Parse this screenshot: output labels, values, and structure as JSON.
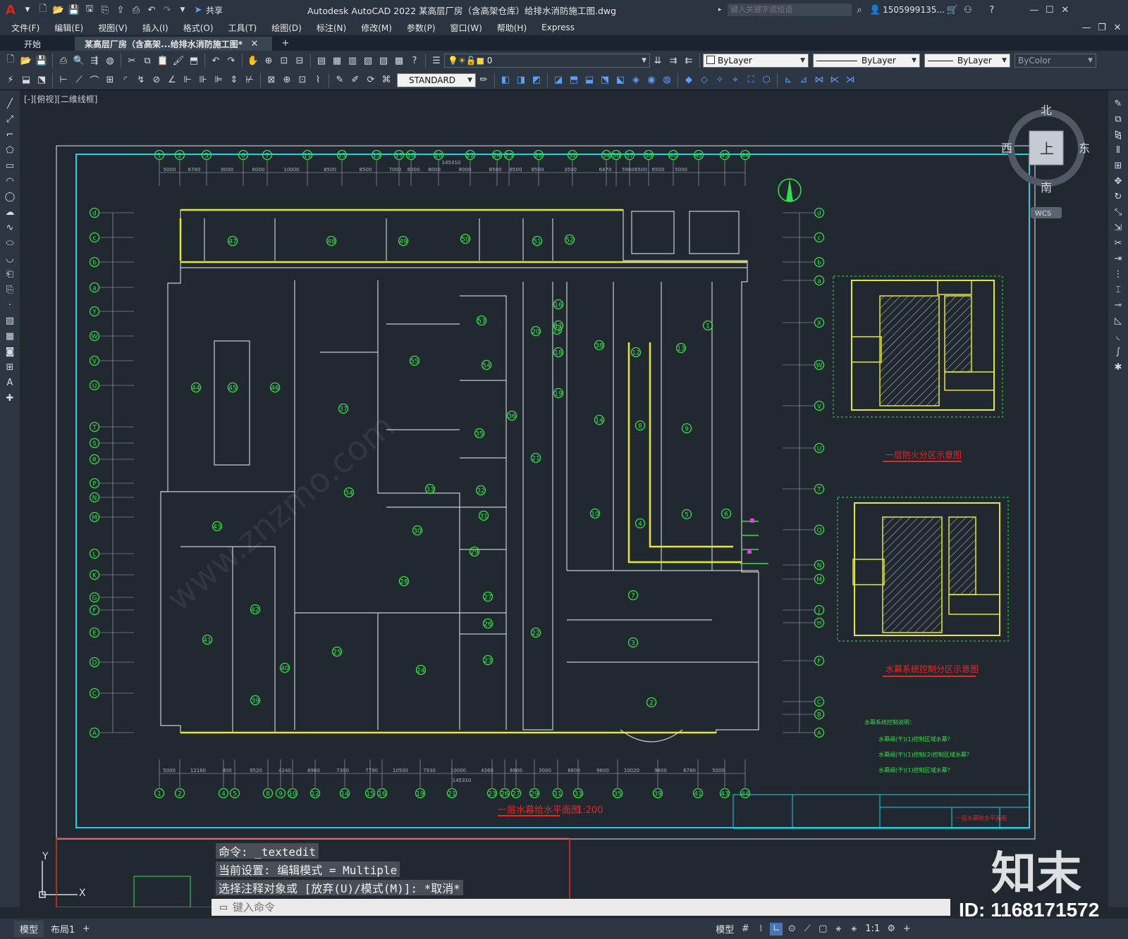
{
  "app": {
    "title": "Autodesk AutoCAD 2022    某高层厂房（含高架仓库）给排水消防施工图.dwg",
    "share_label": "共享",
    "search_placeholder": "键入关键字或短语",
    "user_id": "1505999135...",
    "logo_letter": "A"
  },
  "menu": [
    "文件(F)",
    "编辑(E)",
    "视图(V)",
    "插入(I)",
    "格式(O)",
    "工具(T)",
    "绘图(D)",
    "标注(N)",
    "修改(M)",
    "参数(P)",
    "窗口(W)",
    "帮助(H)",
    "Express"
  ],
  "tabs": {
    "start": "开始",
    "file": "某高层厂房（含高架...给排水消防施工图*"
  },
  "toolbar": {
    "layer_value": "0",
    "color_value": "ByLayer",
    "linetype_value": "ByLayer",
    "lineweight_value": "ByLayer",
    "plotstyle_value": "ByColor",
    "textstyle_value": "STANDARD"
  },
  "viewport": {
    "label": "[-][俯视][二维线框]"
  },
  "viewcube": {
    "north": "北",
    "south": "南",
    "east": "东",
    "west": "西",
    "face": "上",
    "wcs": "WCS"
  },
  "drawing": {
    "top_axes": [
      "1",
      "2",
      "3",
      "6",
      "7",
      "11",
      "13",
      "15",
      "17",
      "18",
      "20",
      "22",
      "24",
      "25",
      "28",
      "32",
      "34",
      "36",
      "37",
      "38",
      "40",
      "42",
      "43",
      "44"
    ],
    "top_dims": [
      "5000",
      "6780",
      "9000",
      "6000",
      "10000",
      "8500",
      "8500",
      "7000",
      "8000",
      "8000",
      "8000",
      "8500",
      "8500",
      "8500",
      "3500",
      "6470",
      "5960",
      "6500",
      "6500",
      "5000"
    ],
    "top_total": "145310",
    "bottom_axes": [
      "1",
      "2",
      "4",
      "5",
      "8",
      "9",
      "10",
      "12",
      "14",
      "15",
      "16",
      "19",
      "21",
      "23",
      "26",
      "27",
      "29",
      "31",
      "33",
      "35",
      "39",
      "41",
      "43",
      "44"
    ],
    "bottom_dims": [
      "5000",
      "12160",
      "400",
      "9520",
      "4240",
      "6960",
      "7300",
      "7790",
      "10500",
      "7930",
      "10000",
      "4360",
      "6900",
      "3000",
      "6600",
      "9600",
      "10020",
      "9800",
      "6780",
      "5000"
    ],
    "bottom_total": "145310",
    "left_axes": [
      "d",
      "c",
      "b",
      "a",
      "Y",
      "W",
      "V",
      "U",
      "T",
      "S",
      "R",
      "P",
      "N",
      "M",
      "L",
      "K",
      "G",
      "F",
      "E",
      "D",
      "C",
      "A"
    ],
    "right_axes": [
      "d",
      "c",
      "b",
      "a",
      "X",
      "W",
      "V",
      "U",
      "T",
      "Q",
      "N",
      "M",
      "J",
      "H",
      "F",
      "C",
      "B",
      "A"
    ],
    "zone_numbers": [
      "47",
      "48",
      "49",
      "50",
      "51",
      "52",
      "53",
      "55",
      "54",
      "37",
      "36",
      "35",
      "34",
      "33",
      "32",
      "31",
      "30",
      "29",
      "28",
      "27",
      "26",
      "25",
      "24",
      "23",
      "22",
      "21",
      "20",
      "19",
      "18",
      "17",
      "16",
      "46",
      "45",
      "44",
      "43",
      "42",
      "41",
      "40",
      "39",
      "38",
      "12",
      "13",
      "14",
      "8",
      "9",
      "10",
      "4",
      "5",
      "6",
      "7",
      "3",
      "2",
      "1",
      "11"
    ],
    "plan_title": "一层水幕给水平面图",
    "plan_scale": "1:200",
    "detail1_title": "一层防火分区示意图",
    "detail2_title": "水幕系统控制分区示意图",
    "note_title": "水幕系统控制说明：",
    "notes": [
      "水幕阀(干)(1)控制区域水幕？",
      "水幕阀(干)(1)控制(2)控制区域水幕？",
      "水幕阀(干)(1)控制区域水幕？"
    ],
    "titleblock_text": "一层水幕给水平面图"
  },
  "command": {
    "history": [
      "命令: _textedit",
      "当前设置: 编辑模式 = Multiple",
      "选择注释对象或 [放弃(U)/模式(M)]: *取消*"
    ],
    "placeholder": "键入命令"
  },
  "layout_tabs": [
    "模型",
    "布局1"
  ],
  "status": {
    "model": "模型",
    "scale": "1:1"
  },
  "watermark": {
    "brand": "知末",
    "id": "ID: 1168171572",
    "site": "www.znzmo.com"
  },
  "colors": {
    "frame_cyan": "#19d3e6",
    "wall_yellow": "#e8e82a",
    "axis_green": "#2fe24a",
    "title_red": "#e02a2a",
    "cmd_bg": "#4a4f57"
  }
}
